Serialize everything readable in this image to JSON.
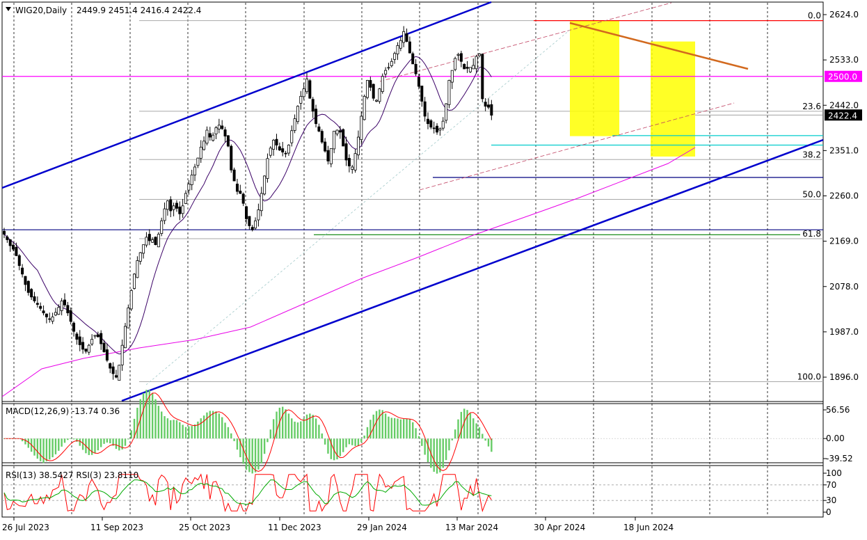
{
  "chart_data": {
    "type": "candlestick",
    "header": {
      "symbol_timeframe": "WIG20,Daily",
      "ohlc_text": "2449.9 2451.4 2416.4 2422.4"
    },
    "price_axis": {
      "ticks": [
        2624.0,
        2533.0,
        2442.0,
        2351.0,
        2260.0,
        2169.0,
        2078.0,
        1987.0,
        1896.0
      ],
      "tick_labels": [
        "2624.0",
        "2533.0",
        "2442.0",
        "2351.0",
        "2260.0",
        "2169.0",
        "2078.0",
        "1987.0",
        "1896.0"
      ],
      "current_price_label": "2422.4",
      "current_price": 2422.4,
      "level_label": "2500.0",
      "level": 2500.0,
      "range": [
        1866,
        2650
      ]
    },
    "time_axis": {
      "labels": [
        "26 Jul 2023",
        "11 Sep 2023",
        "25 Oct 2023",
        "11 Dec 2023",
        "29 Jan 2024",
        "13 Mar 2024",
        "30 Apr 2024",
        "18 Jun 2024"
      ]
    },
    "fibonacci": {
      "levels": [
        {
          "label": "0.0",
          "price": 2612
        },
        {
          "label": "23.6",
          "price": 2430
        },
        {
          "label": "38.2",
          "price": 2333
        },
        {
          "label": "50.0",
          "price": 2253
        },
        {
          "label": "61.8",
          "price": 2174
        },
        {
          "label": "100.0",
          "price": 1887
        }
      ]
    },
    "horizontal_levels": [
      {
        "price": 2612,
        "color": "#ff0000"
      },
      {
        "price": 2500,
        "color": "#ff00ff"
      },
      {
        "price": 2381,
        "color": "#00cccc"
      },
      {
        "price": 2362,
        "color": "#00cccc"
      },
      {
        "price": 2297,
        "color": "#000080"
      },
      {
        "price": 2192,
        "color": "#000080"
      },
      {
        "price": 2182,
        "color": "#008000"
      }
    ],
    "close_series": [
      2183,
      2172,
      2160,
      2153,
      2140,
      2120,
      2103,
      2082,
      2066,
      2057,
      2049,
      2042,
      2034,
      2025,
      2017,
      2012,
      2017,
      2026,
      2036,
      2049,
      2041,
      2025,
      2008,
      1988,
      1972,
      1961,
      1952,
      1948,
      1960,
      1972,
      1980,
      1977,
      1963,
      1947,
      1930,
      1914,
      1903,
      1896,
      1920,
      1960,
      1998,
      2035,
      2070,
      2103,
      2130,
      2146,
      2162,
      2177,
      2170,
      2172,
      2162,
      2183,
      2210,
      2234,
      2250,
      2230,
      2240,
      2235,
      2224,
      2240,
      2265,
      2284,
      2302,
      2318,
      2336,
      2358,
      2370,
      2392,
      2378,
      2382,
      2397,
      2402,
      2395,
      2380,
      2360,
      2312,
      2290,
      2269,
      2265,
      2245,
      2214,
      2200,
      2192,
      2210,
      2232,
      2265,
      2300,
      2335,
      2356,
      2372,
      2362,
      2352,
      2348,
      2345,
      2362,
      2391,
      2415,
      2440,
      2460,
      2475,
      2495,
      2456,
      2430,
      2405,
      2390,
      2368,
      2350,
      2330,
      2355,
      2390,
      2392,
      2388,
      2360,
      2332,
      2320,
      2318,
      2345,
      2378,
      2420,
      2460,
      2492,
      2478,
      2456,
      2452,
      2475,
      2500,
      2512,
      2518,
      2530,
      2546,
      2562,
      2572,
      2590,
      2570,
      2547,
      2525,
      2505,
      2480,
      2450,
      2420,
      2405,
      2398,
      2395,
      2388,
      2395,
      2410,
      2445,
      2492,
      2512,
      2536,
      2544,
      2530,
      2515,
      2516,
      2518,
      2522,
      2540,
      2545,
      2455,
      2440,
      2438,
      2422
    ],
    "candle_colors": {
      "bull": "#008000",
      "bear": "#000000"
    },
    "ma50_color": "#3a0066",
    "ma200_color": "#e800e8",
    "trend_channel_color": "#0000cd",
    "resistance_trendline_color": "#d2691e",
    "highlight_color": "#ffff00",
    "macd": {
      "label": "MACD(12,26,9) -13.74 0.36",
      "scale_labels": [
        "56.56",
        "0.00",
        "-39.52"
      ],
      "top": 56.56,
      "bottom": -39.52,
      "hist_color": "#66cc66",
      "signal_color": "#ff0000"
    },
    "rsi": {
      "label": "RSI(13) 38.5427  RSI(3) 23.8110",
      "scale_labels": [
        "100",
        "70",
        "30",
        "0"
      ],
      "fast_color": "#ff0000",
      "slow_color": "#00aa00"
    }
  }
}
